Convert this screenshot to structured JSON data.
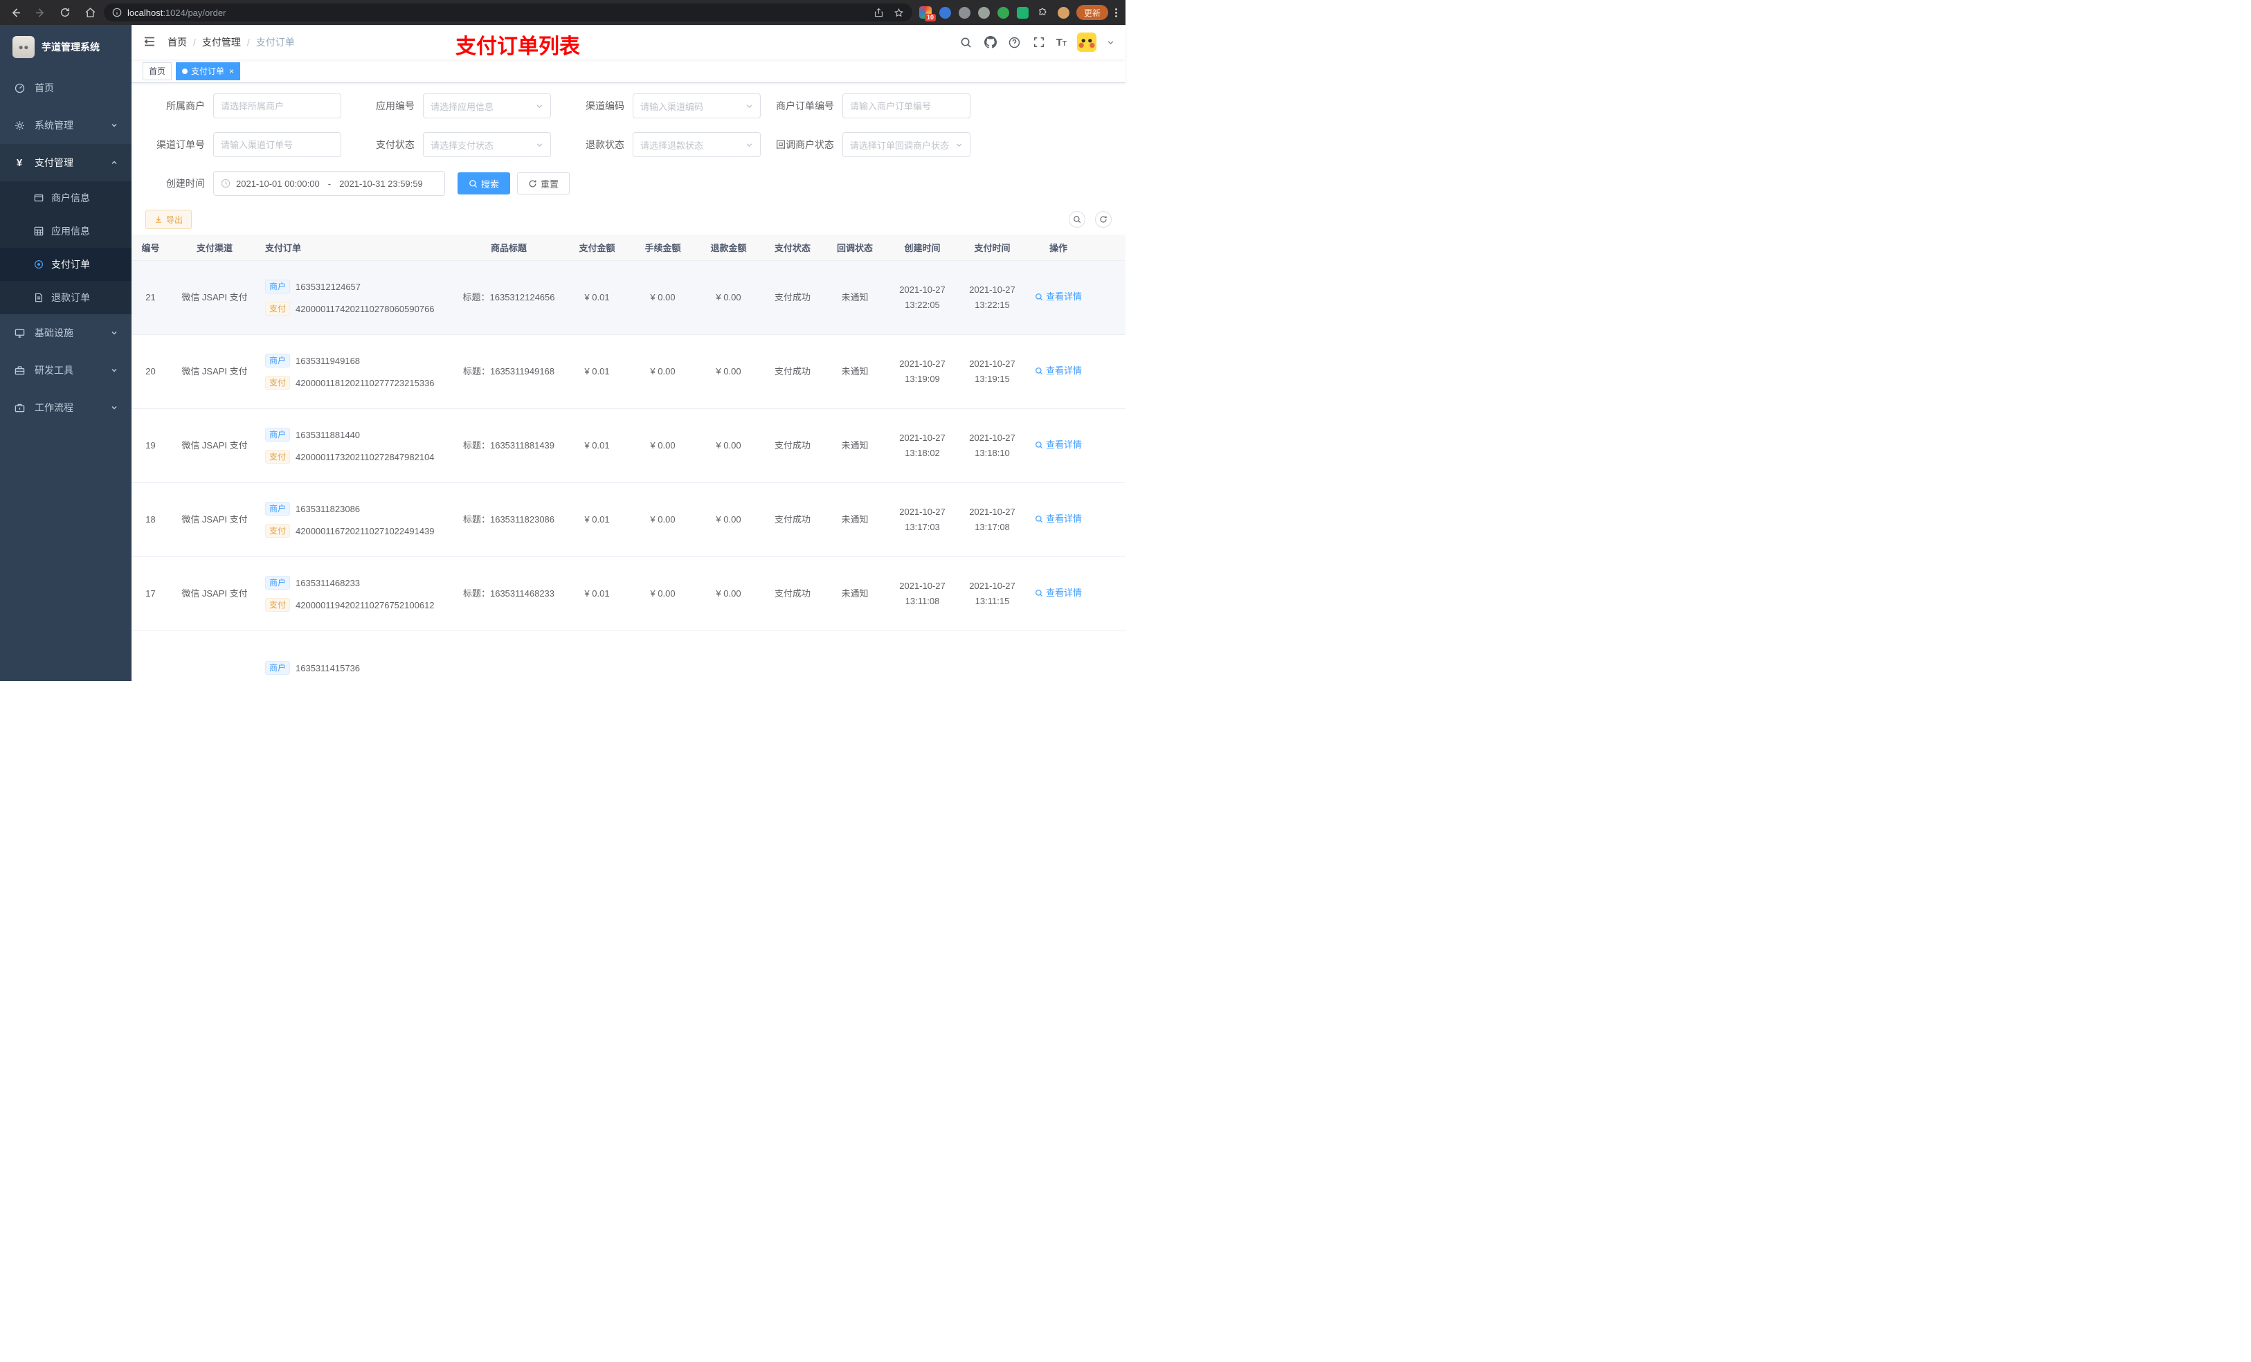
{
  "browser": {
    "url_host": "localhost",
    "url_rest": ":1024/pay/order",
    "extension_badge": "10",
    "update_label": "更新"
  },
  "sidebar": {
    "logo_title": "芋道管理系统",
    "menu": [
      {
        "label": "首页"
      },
      {
        "label": "系统管理"
      },
      {
        "label": "支付管理"
      },
      {
        "label": "基础设施"
      },
      {
        "label": "研发工具"
      },
      {
        "label": "工作流程"
      }
    ],
    "submenu": [
      {
        "label": "商户信息"
      },
      {
        "label": "应用信息"
      },
      {
        "label": "支付订单"
      },
      {
        "label": "退款订单"
      }
    ]
  },
  "navbar": {
    "breadcrumb": [
      "首页",
      "支付管理",
      "支付订单"
    ],
    "annotation": "支付订单列表"
  },
  "tags": [
    {
      "label": "首页"
    },
    {
      "label": "支付订单"
    }
  ],
  "filters": {
    "fields": [
      {
        "label": "所属商户",
        "placeholder": "请选择所属商户"
      },
      {
        "label": "应用编号",
        "placeholder": "请选择应用信息"
      },
      {
        "label": "渠道编码",
        "placeholder": "请输入渠道编码"
      },
      {
        "label": "商户订单编号",
        "placeholder": "请输入商户订单编号"
      },
      {
        "label": "渠道订单号",
        "placeholder": "请输入渠道订单号"
      },
      {
        "label": "支付状态",
        "placeholder": "请选择支付状态"
      },
      {
        "label": "退款状态",
        "placeholder": "请选择退款状态"
      },
      {
        "label": "回调商户状态",
        "placeholder": "请选择订单回调商户状态"
      }
    ],
    "create_time_label": "创建时间",
    "date_start": "2021-10-01 00:00:00",
    "date_separator": "-",
    "date_end": "2021-10-31 23:59:59",
    "search_label": "搜索",
    "reset_label": "重置",
    "export_label": "导出"
  },
  "table": {
    "columns": [
      "编号",
      "支付渠道",
      "支付订单",
      "商品标题",
      "支付金额",
      "手续金额",
      "退款金额",
      "支付状态",
      "回调状态",
      "创建时间",
      "支付时间",
      "操作"
    ],
    "merchant_tag": "商户",
    "pay_tag": "支付",
    "title_prefix": "标题：",
    "action_label": "查看详情",
    "rows": [
      {
        "id": "21",
        "channel": "微信 JSAPI 支付",
        "merchant_no": "1635312124657",
        "pay_no": "4200001174202110278060590766",
        "title": "1635312124656",
        "amount": "¥ 0.01",
        "fee": "¥ 0.00",
        "refund": "¥ 0.00",
        "status": "支付成功",
        "notify": "未通知",
        "create_date": "2021-10-27",
        "create_time": "13:22:05",
        "pay_date": "2021-10-27",
        "pay_time": "13:22:15"
      },
      {
        "id": "20",
        "channel": "微信 JSAPI 支付",
        "merchant_no": "1635311949168",
        "pay_no": "4200001181202110277723215336",
        "title": "1635311949168",
        "amount": "¥ 0.01",
        "fee": "¥ 0.00",
        "refund": "¥ 0.00",
        "status": "支付成功",
        "notify": "未通知",
        "create_date": "2021-10-27",
        "create_time": "13:19:09",
        "pay_date": "2021-10-27",
        "pay_time": "13:19:15"
      },
      {
        "id": "19",
        "channel": "微信 JSAPI 支付",
        "merchant_no": "1635311881440",
        "pay_no": "4200001173202110272847982104",
        "title": "1635311881439",
        "amount": "¥ 0.01",
        "fee": "¥ 0.00",
        "refund": "¥ 0.00",
        "status": "支付成功",
        "notify": "未通知",
        "create_date": "2021-10-27",
        "create_time": "13:18:02",
        "pay_date": "2021-10-27",
        "pay_time": "13:18:10"
      },
      {
        "id": "18",
        "channel": "微信 JSAPI 支付",
        "merchant_no": "1635311823086",
        "pay_no": "4200001167202110271022491439",
        "title": "1635311823086",
        "amount": "¥ 0.01",
        "fee": "¥ 0.00",
        "refund": "¥ 0.00",
        "status": "支付成功",
        "notify": "未通知",
        "create_date": "2021-10-27",
        "create_time": "13:17:03",
        "pay_date": "2021-10-27",
        "pay_time": "13:17:08"
      },
      {
        "id": "17",
        "channel": "微信 JSAPI 支付",
        "merchant_no": "1635311468233",
        "pay_no": "4200001194202110276752100612",
        "title": "1635311468233",
        "amount": "¥ 0.01",
        "fee": "¥ 0.00",
        "refund": "¥ 0.00",
        "status": "支付成功",
        "notify": "未通知",
        "create_date": "2021-10-27",
        "create_time": "13:11:08",
        "pay_date": "2021-10-27",
        "pay_time": "13:11:15"
      }
    ],
    "partial_row": {
      "merchant_no": "1635311415736"
    }
  },
  "colors": {
    "primary": "#409eff",
    "warning": "#e6a23c",
    "annotation_red": "#ff0000",
    "sidebar_bg": "#304156",
    "submenu_bg": "#1f2d3d",
    "active_tag_bg": "#409eff"
  }
}
